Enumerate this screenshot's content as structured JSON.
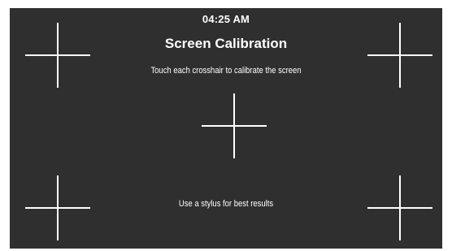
{
  "status_bar": {
    "time": "04:25 AM"
  },
  "calibration": {
    "title": "Screen Calibration",
    "instruction": "Touch each crosshair to calibrate the screen",
    "hint": "Use a stylus for best results",
    "targets": [
      "top-left",
      "top-right",
      "center",
      "bottom-left",
      "bottom-right"
    ]
  },
  "colors": {
    "background": "#2f2f2f",
    "foreground": "#ffffff",
    "frame": "#ffffff"
  }
}
